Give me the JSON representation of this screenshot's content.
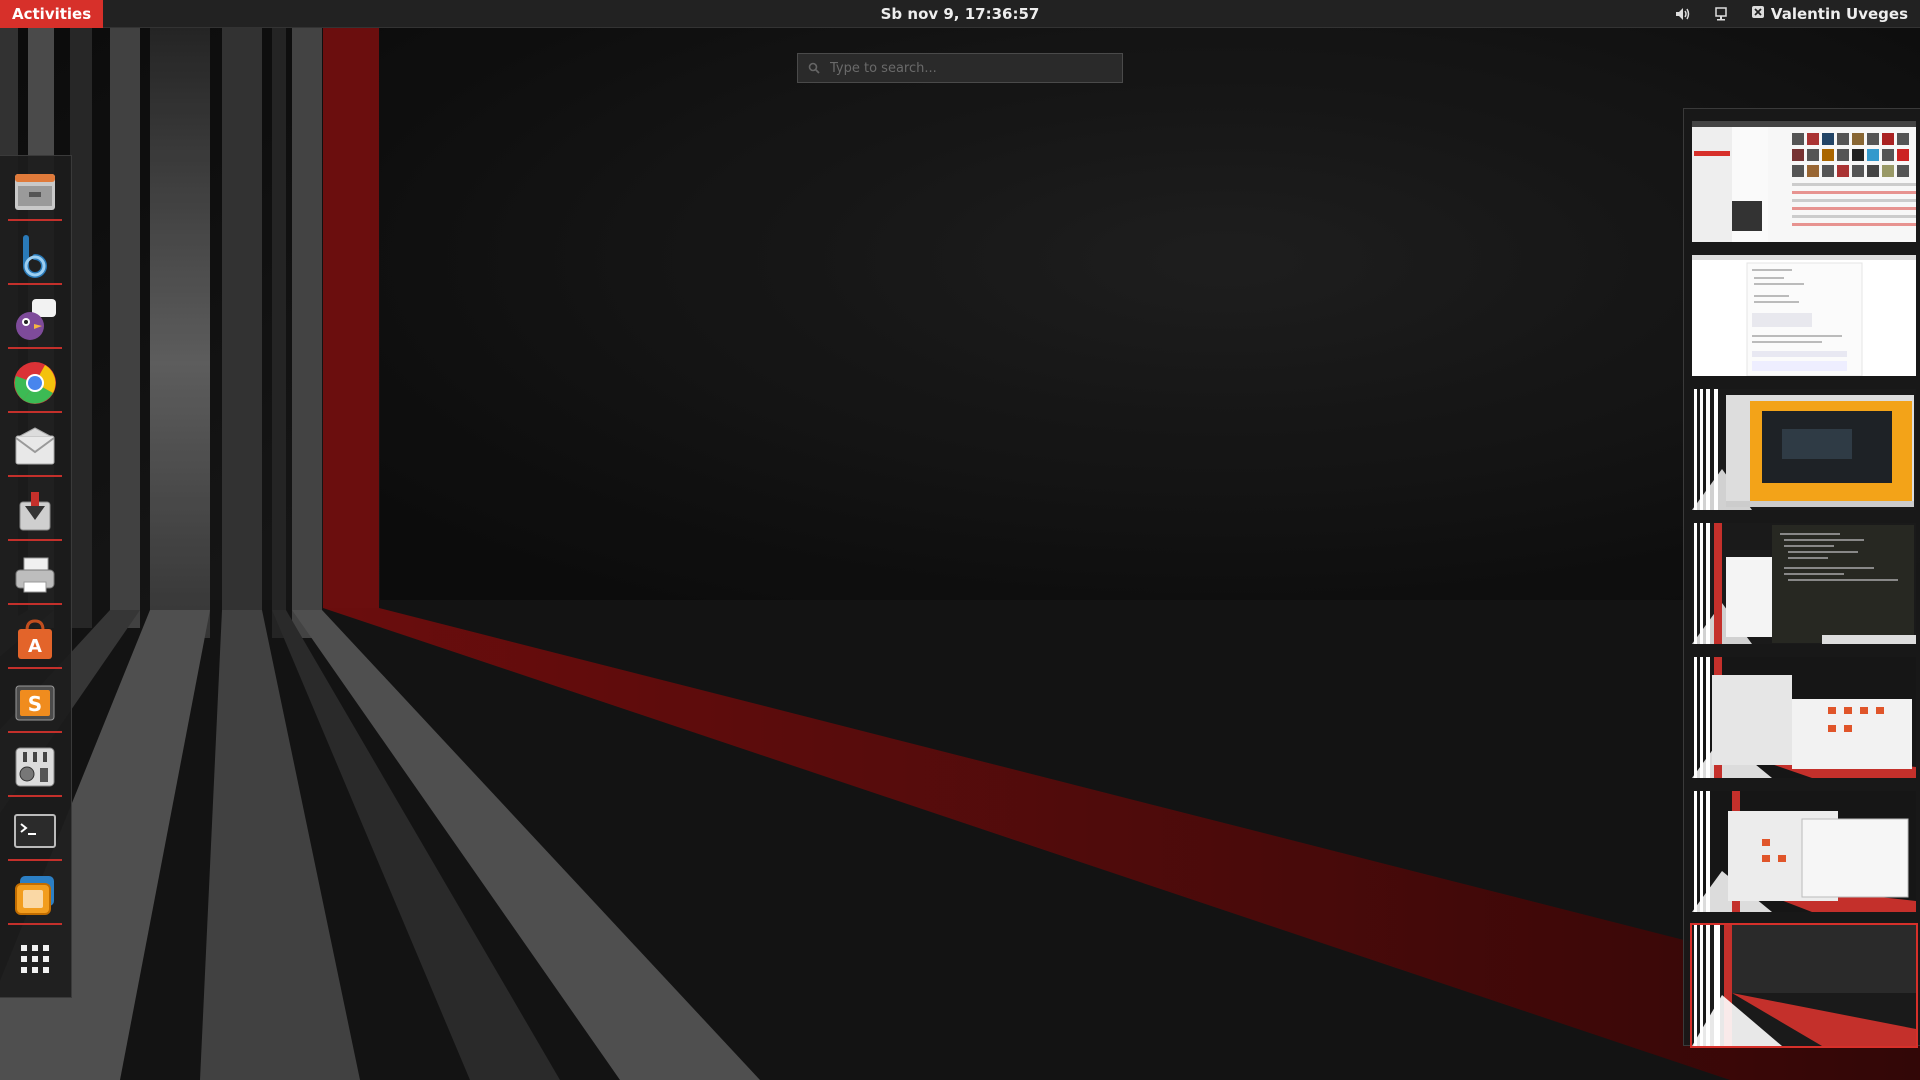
{
  "topbar": {
    "activities_label": "Activities",
    "clock": "Sb nov  9, 17:36:57",
    "user_name": "Valentin Uveges",
    "icons": [
      "volume-icon",
      "network-icon",
      "user-icon"
    ]
  },
  "search": {
    "placeholder": "Type to search..."
  },
  "dash": {
    "items": [
      {
        "name": "files",
        "icon": "file-cabinet-icon",
        "running": true
      },
      {
        "name": "banshee",
        "icon": "banshee-icon",
        "running": true
      },
      {
        "name": "pidgin",
        "icon": "pidgin-icon",
        "running": true
      },
      {
        "name": "chrome",
        "icon": "chrome-icon",
        "running": true
      },
      {
        "name": "mail",
        "icon": "envelope-icon",
        "running": true
      },
      {
        "name": "transmission",
        "icon": "download-icon",
        "running": true
      },
      {
        "name": "printer",
        "icon": "printer-icon",
        "running": true
      },
      {
        "name": "software-center",
        "icon": "shopping-bag-icon",
        "running": true
      },
      {
        "name": "sublime-text",
        "icon": "sublime-icon",
        "running": true
      },
      {
        "name": "mixer",
        "icon": "equalizer-icon",
        "running": true
      },
      {
        "name": "terminal",
        "icon": "terminal-icon",
        "running": true
      },
      {
        "name": "virtualbox",
        "icon": "virtualbox-icon",
        "running": true
      },
      {
        "name": "show-applications",
        "icon": "grid-icon",
        "running": false
      }
    ]
  },
  "workspaces": {
    "count": 7,
    "active_index": 6
  },
  "colors": {
    "accent": "#d7302a",
    "topbar": "#222222",
    "panel": "#1c1c1c"
  }
}
